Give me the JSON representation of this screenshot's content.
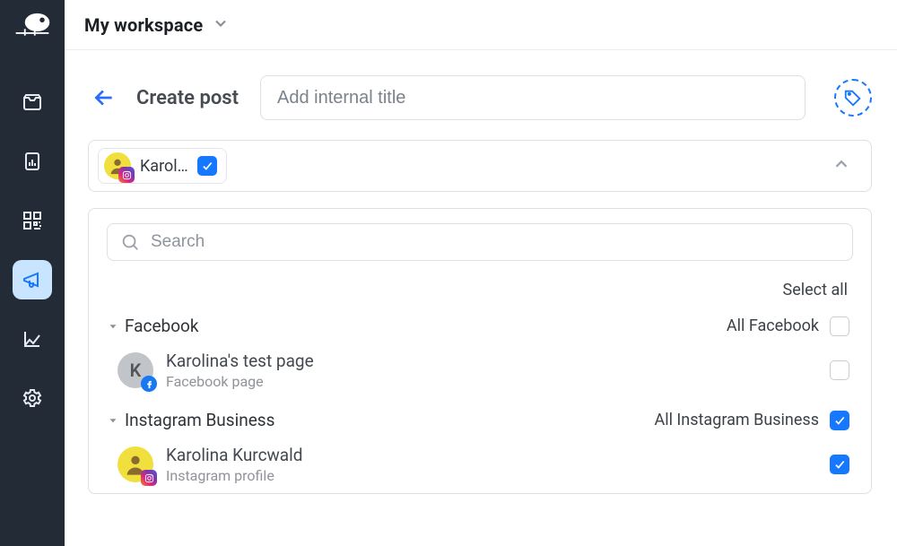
{
  "header": {
    "workspace": "My workspace"
  },
  "create": {
    "back_aria": "Back",
    "title": "Create post",
    "input_placeholder": "Add internal title",
    "tag_aria": "Add tag"
  },
  "selector": {
    "chip": {
      "name": "Karol…"
    },
    "search_placeholder": "Search",
    "select_all": "Select all",
    "groups": [
      {
        "title": "Facebook",
        "all_label": "All Facebook",
        "all_checked": false,
        "items": [
          {
            "title": "Karolina's test page",
            "sub": "Facebook page",
            "checked": false,
            "platform": "fb",
            "avatar_letter": "K"
          }
        ]
      },
      {
        "title": "Instagram Business",
        "all_label": "All Instagram Business",
        "all_checked": true,
        "items": [
          {
            "title": "Karolina Kurcwald",
            "sub": "Instagram profile",
            "checked": true,
            "platform": "ig"
          }
        ]
      }
    ]
  }
}
